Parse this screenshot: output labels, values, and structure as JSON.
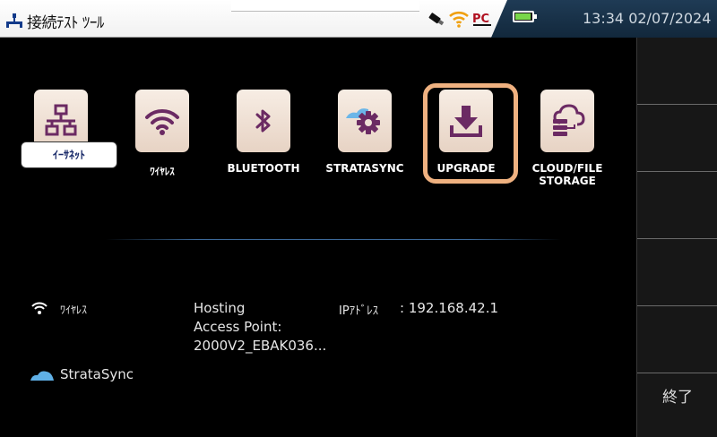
{
  "header": {
    "app_title": "接続ﾃｽﾄ ﾂｰﾙ",
    "icons": [
      "network-app-icon",
      "usb-icon",
      "wifi-icon",
      "pc-icon"
    ],
    "battery_level": 0.95,
    "clock": "13:34 02/07/2024"
  },
  "tiles": [
    {
      "label": "",
      "icon": "ethernet-icon"
    },
    {
      "label": "ﾜｲﾔﾚｽ",
      "icon": "wifi-icon"
    },
    {
      "label": "BLUETOOTH",
      "icon": "bluetooth-icon"
    },
    {
      "label": "STRATASYNC",
      "icon": "stratasync-gear-icon"
    },
    {
      "label": "UPGRADE",
      "icon": "download-icon"
    },
    {
      "label": "CLOUD/FILE\nSTORAGE",
      "icon": "cloud-storage-icon"
    }
  ],
  "ethernet_badge": "ｲｰｻﾈｯﾄ",
  "status": {
    "wireless_label": "ﾜｲﾔﾚｽ",
    "hosting_line1": "Hosting",
    "hosting_line2": "Access Point:",
    "hosting_line3": "2000V2_EBAK036...",
    "ip_label": "IPｱﾄﾞﾚｽ",
    "ip_value": ": 192.168.42.1",
    "stratasync_label": "StrataSync"
  },
  "rail": {
    "exit_label": "終了"
  },
  "colors": {
    "tile_bg": "#f1e4d8",
    "icon_purple": "#6b2a63",
    "highlight": "#efb180",
    "status_bar": "#1a3550",
    "battery": "#79d74a"
  }
}
